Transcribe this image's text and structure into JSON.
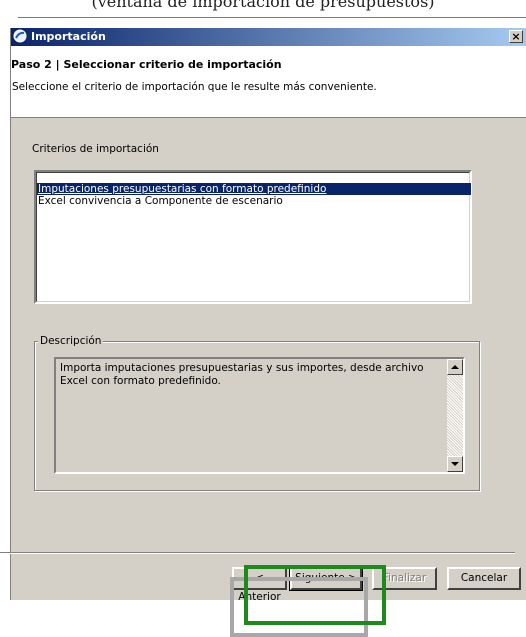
{
  "top_fragment": {
    "text": "(ventana de importación de presupuestos)"
  },
  "window": {
    "title": "Importación",
    "close_glyph": "×"
  },
  "header": {
    "step_title": "Paso 2 | Seleccionar criterio de importación",
    "step_description": "Seleccione el criterio de importación que le resulte más conveniente."
  },
  "criteria": {
    "label": "Criterios de importación",
    "items": [
      {
        "label": "Imputaciones presupuestarias con formato predefinido",
        "selected": true
      },
      {
        "label": "Excel convivencia a Componente de escenario",
        "selected": false
      }
    ]
  },
  "description": {
    "legend": "Descripción",
    "text": "Importa imputaciones presupuestarias y sus importes, desde archivo Excel con formato predefinido."
  },
  "buttons": {
    "back": "< Anterior",
    "next": "Siguiente >",
    "finish": "Finalizar",
    "cancel": "Cancelar"
  },
  "icons": {
    "app": "import-app-icon",
    "close": "close-icon",
    "scroll_up": "arrow-up-icon",
    "scroll_down": "arrow-down-icon"
  },
  "colors": {
    "titlebar_start": "#0a246a",
    "titlebar_end": "#a6caf0",
    "selection": "#0a246a",
    "highlight_green": "#1e8a1e",
    "highlight_gray": "#a8a8a8"
  }
}
